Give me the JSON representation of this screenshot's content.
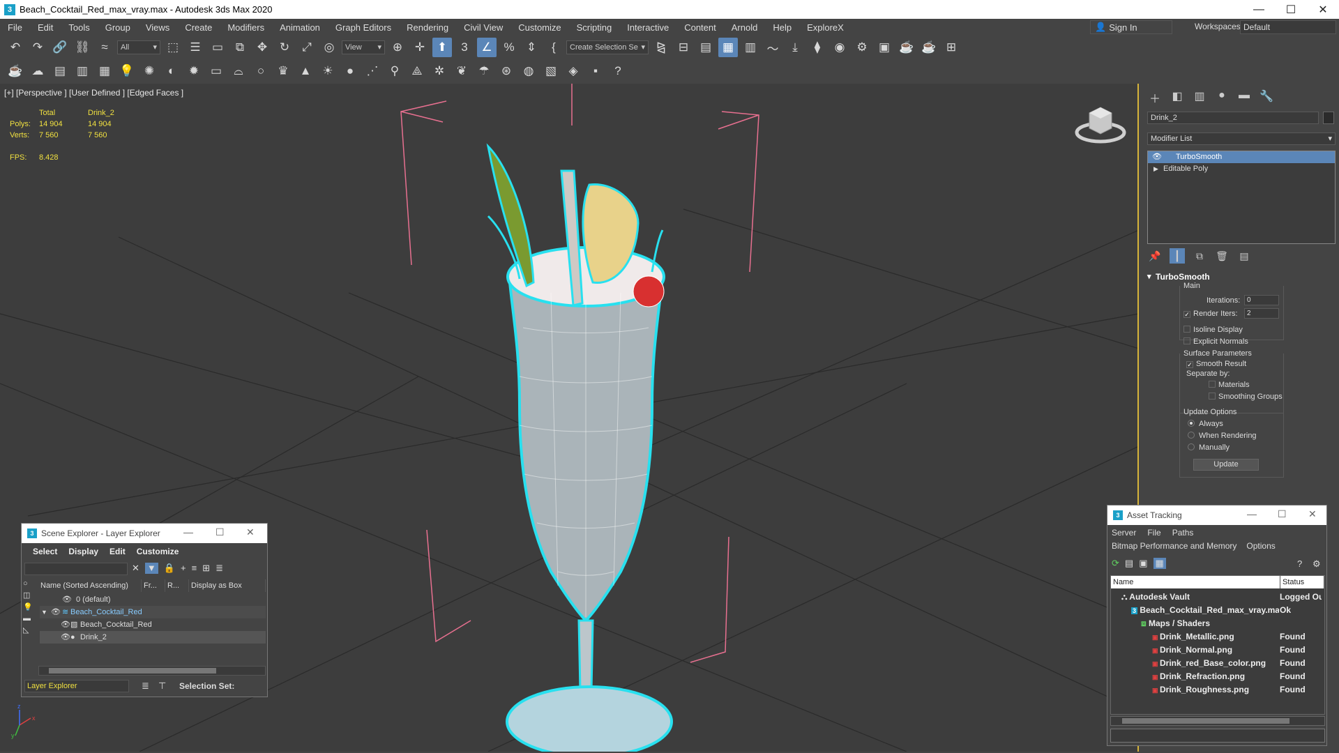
{
  "window": {
    "title": "Beach_Cocktail_Red_max_vray.max - Autodesk 3ds Max 2020",
    "app_icon": "3"
  },
  "menu": {
    "items": [
      "File",
      "Edit",
      "Tools",
      "Group",
      "Views",
      "Create",
      "Modifiers",
      "Animation",
      "Graph Editors",
      "Rendering",
      "Civil View",
      "Customize",
      "Scripting",
      "Interactive",
      "Content",
      "Arnold",
      "Help",
      "ExploreX"
    ],
    "sign_in": "Sign In",
    "workspaces_label": "Workspaces:",
    "workspaces_value": "Default"
  },
  "toolbar": {
    "selection_filter": "All",
    "ref_coord": "View",
    "named_selection": "Create Selection Se"
  },
  "viewport": {
    "label": "[+] [Perspective ] [User Defined ] [Edged Faces ]",
    "stats": {
      "col_total": "Total",
      "col_object": "Drink_2",
      "polys_label": "Polys:",
      "polys_total": "14 904",
      "polys_object": "14 904",
      "verts_label": "Verts:",
      "verts_total": "7 560",
      "verts_object": "7 560",
      "fps_label": "FPS:",
      "fps_value": "8.428"
    },
    "axis_x": "x",
    "axis_y": "y",
    "axis_z": "z",
    "colors": {
      "background": "#3d3d3d",
      "grid": "#2a2a2a",
      "wire": "#ffffff",
      "highlight": "#28e0ef",
      "bbox": "#e87090"
    }
  },
  "command_panel": {
    "object_name": "Drink_2",
    "modifier_list": "Modifier List",
    "stack": [
      "TurboSmooth",
      "Editable Poly"
    ],
    "rollout_title": "TurboSmooth",
    "main_group": "Main",
    "iterations_label": "Iterations:",
    "iterations_value": "0",
    "render_iters_label": "Render Iters:",
    "render_iters_value": "2",
    "isoline_display": "Isoline Display",
    "explicit_normals": "Explicit Normals",
    "surface_params": "Surface Parameters",
    "smooth_result": "Smooth Result",
    "separate_by": "Separate by:",
    "materials": "Materials",
    "smoothing_groups": "Smoothing Groups",
    "update_options": "Update Options",
    "always": "Always",
    "when_rendering": "When Rendering",
    "manually": "Manually",
    "update_button": "Update"
  },
  "scene_explorer": {
    "title": "Scene Explorer - Layer Explorer",
    "menu": [
      "Select",
      "Display",
      "Edit",
      "Customize"
    ],
    "columns": [
      "Name (Sorted Ascending)",
      "Fr...",
      "R...",
      "Display as Box"
    ],
    "rows": [
      {
        "name": "0 (default)"
      },
      {
        "name": "Beach_Cocktail_Red"
      },
      {
        "name": "Beach_Cocktail_Red"
      },
      {
        "name": "Drink_2"
      }
    ],
    "footer_layer": "Layer Explorer",
    "footer_selection": "Selection Set:"
  },
  "asset_tracking": {
    "title": "Asset Tracking",
    "menu_row1": [
      "Server",
      "File",
      "Paths"
    ],
    "menu_row2": [
      "Bitmap Performance and Memory",
      "Options"
    ],
    "col_name": "Name",
    "col_status": "Status",
    "rows": [
      {
        "name": "Autodesk Vault",
        "status": "Logged Ou"
      },
      {
        "name": "Beach_Cocktail_Red_max_vray.max",
        "status": "Ok"
      },
      {
        "name": "Maps / Shaders",
        "status": ""
      },
      {
        "name": "Drink_Metallic.png",
        "status": "Found"
      },
      {
        "name": "Drink_Normal.png",
        "status": "Found"
      },
      {
        "name": "Drink_red_Base_color.png",
        "status": "Found"
      },
      {
        "name": "Drink_Refraction.png",
        "status": "Found"
      },
      {
        "name": "Drink_Roughness.png",
        "status": "Found"
      }
    ]
  }
}
